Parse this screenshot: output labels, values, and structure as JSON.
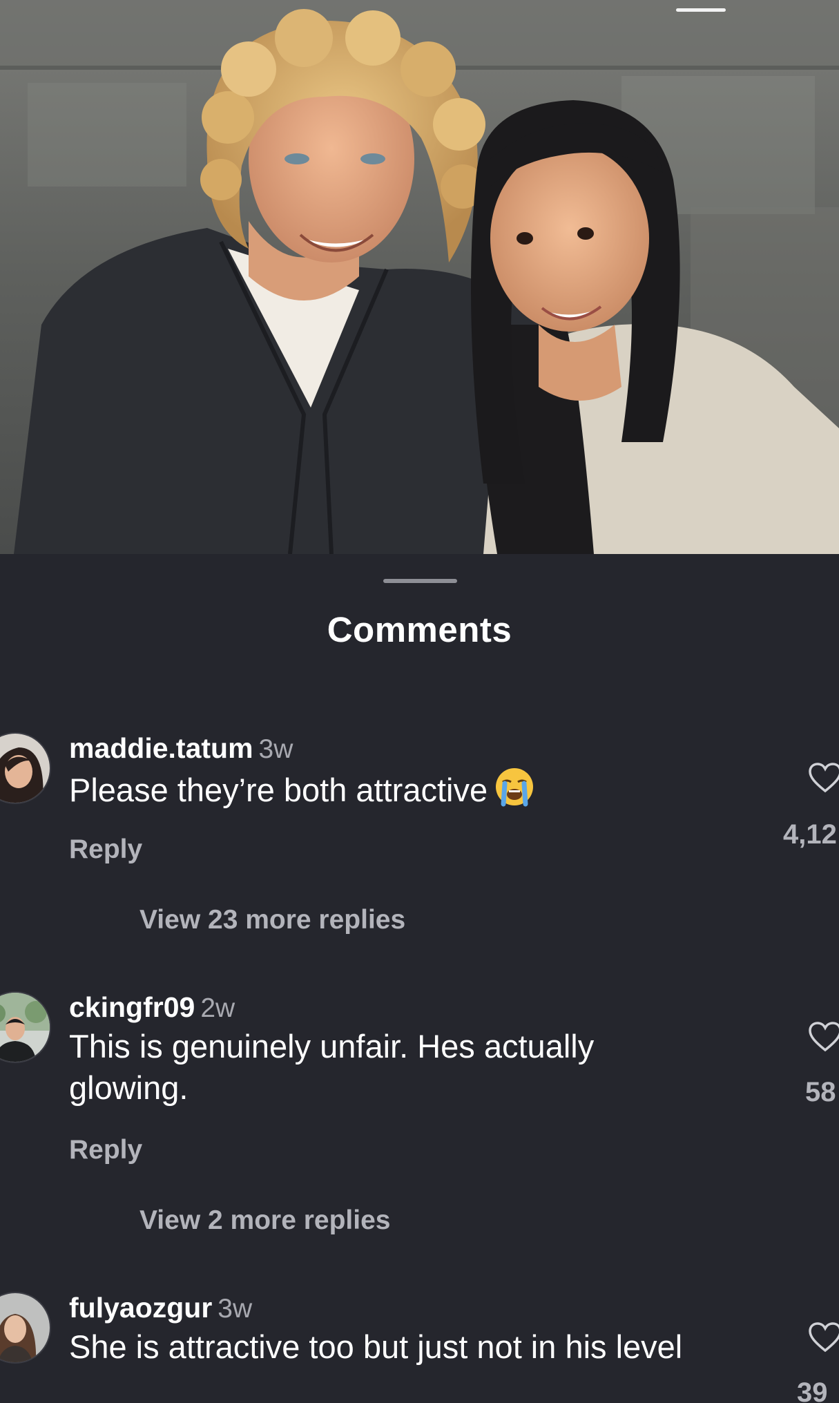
{
  "post": {
    "photo_description_icon": "couple-photo"
  },
  "sheet": {
    "title": "Comments"
  },
  "comments": [
    {
      "username": "maddie.tatum",
      "time": "3w",
      "text": "Please they’re both attractive",
      "emoji": "loudly-crying-face",
      "reply_label": "Reply",
      "view_replies": "View 23 more replies",
      "likes": "4,12"
    },
    {
      "username": "ckingfr09",
      "time": "2w",
      "text": "This is genuinely unfair. Hes actually glowing.",
      "reply_label": "Reply",
      "view_replies": "View 2 more replies",
      "likes": "58"
    },
    {
      "username": "fulyaozgur",
      "time": "3w",
      "text": "She is attractive too but just not in his level",
      "likes": "39"
    }
  ],
  "colors": {
    "sheet_bg": "#25262d",
    "primary_text": "#ffffff",
    "secondary_text": "#b3b4bb"
  },
  "icons": [
    "heart-icon",
    "loudly-crying-face-emoji",
    "avatar"
  ]
}
